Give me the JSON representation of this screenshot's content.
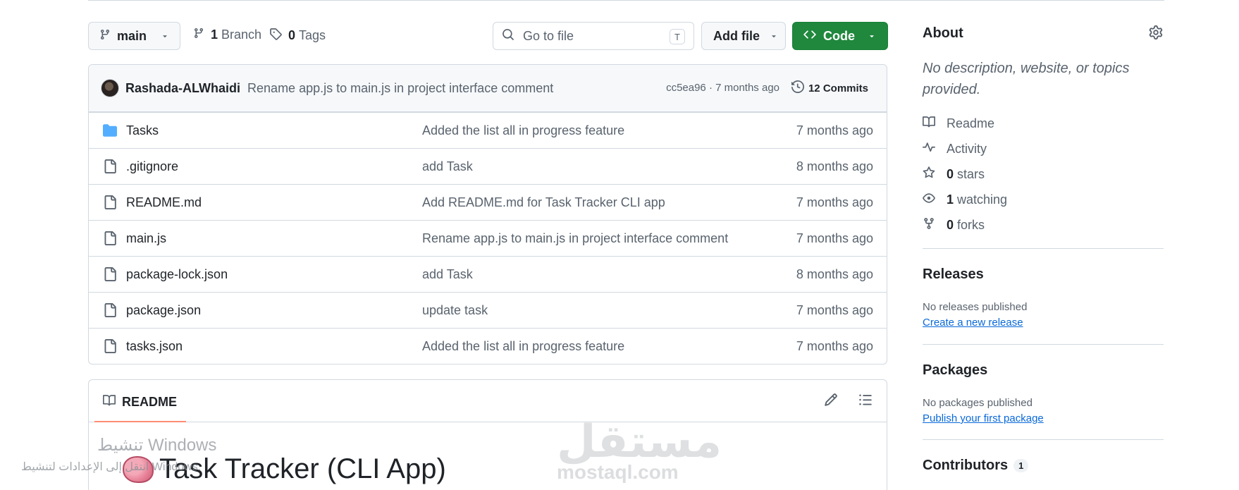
{
  "toolbar": {
    "branch": "main",
    "branch_count": "1",
    "branch_label": "Branch",
    "tag_count": "0",
    "tag_label": "Tags",
    "goto_placeholder": "Go to file",
    "goto_shortcut": "T",
    "add_file": "Add file",
    "code": "Code"
  },
  "commit": {
    "author": "Rashada-ALWhaidi",
    "message": "Rename app.js to main.js in project interface comment",
    "meta": "cc5ea96 · 7 months ago",
    "commits_label": "12 Commits"
  },
  "files": [
    {
      "name": "Tasks",
      "type": "folder",
      "message": "Added the list all in progress feature",
      "age": "7 months ago"
    },
    {
      "name": ".gitignore",
      "type": "file",
      "message": "add Task",
      "age": "8 months ago"
    },
    {
      "name": "README.md",
      "type": "file",
      "message": "Add README.md for Task Tracker CLI app",
      "age": "7 months ago"
    },
    {
      "name": "main.js",
      "type": "file",
      "message": "Rename app.js to main.js in project interface comment",
      "age": "7 months ago"
    },
    {
      "name": "package-lock.json",
      "type": "file",
      "message": "add Task",
      "age": "8 months ago"
    },
    {
      "name": "package.json",
      "type": "file",
      "message": "update task",
      "age": "7 months ago"
    },
    {
      "name": "tasks.json",
      "type": "file",
      "message": "Added the list all in progress feature",
      "age": "7 months ago"
    }
  ],
  "readme": {
    "tab": "README",
    "title": "Task Tracker (CLI App)"
  },
  "watermarks": {
    "windows_line1": "تنشيط Windows",
    "windows_line2": "انتقل إلى الإعدادات لتنشيط Windows.",
    "mostaql": "مستقل",
    "mostaql_domain": "mostaql.com"
  },
  "sidebar": {
    "about_title": "About",
    "about_desc": "No description, website, or topics provided.",
    "readme_link": "Readme",
    "activity_link": "Activity",
    "stars_count": "0",
    "stars_label": "stars",
    "watching_count": "1",
    "watching_label": "watching",
    "forks_count": "0",
    "forks_label": "forks",
    "releases_title": "Releases",
    "releases_text": "No releases published",
    "releases_link": "Create a new release",
    "packages_title": "Packages",
    "packages_text": "No packages published",
    "packages_link": "Publish your first package",
    "contributors_title": "Contributors",
    "contributors_count": "1"
  },
  "colors": {
    "accent_green": "#1f883d",
    "link_blue": "#0969da",
    "folder_blue": "#54aeff",
    "tab_underline": "#fd8c73"
  },
  "icons": {
    "branch": "git-branch-icon",
    "tag": "tag-icon",
    "search": "search-icon",
    "code": "code-icon",
    "history": "history-icon",
    "folder": "folder-icon",
    "file": "file-icon",
    "book": "book-icon",
    "pencil": "pencil-icon",
    "toc": "list-unordered-icon",
    "gear": "gear-icon",
    "pulse": "pulse-icon",
    "star": "star-icon",
    "eye": "eye-icon",
    "fork": "repo-forked-icon"
  }
}
